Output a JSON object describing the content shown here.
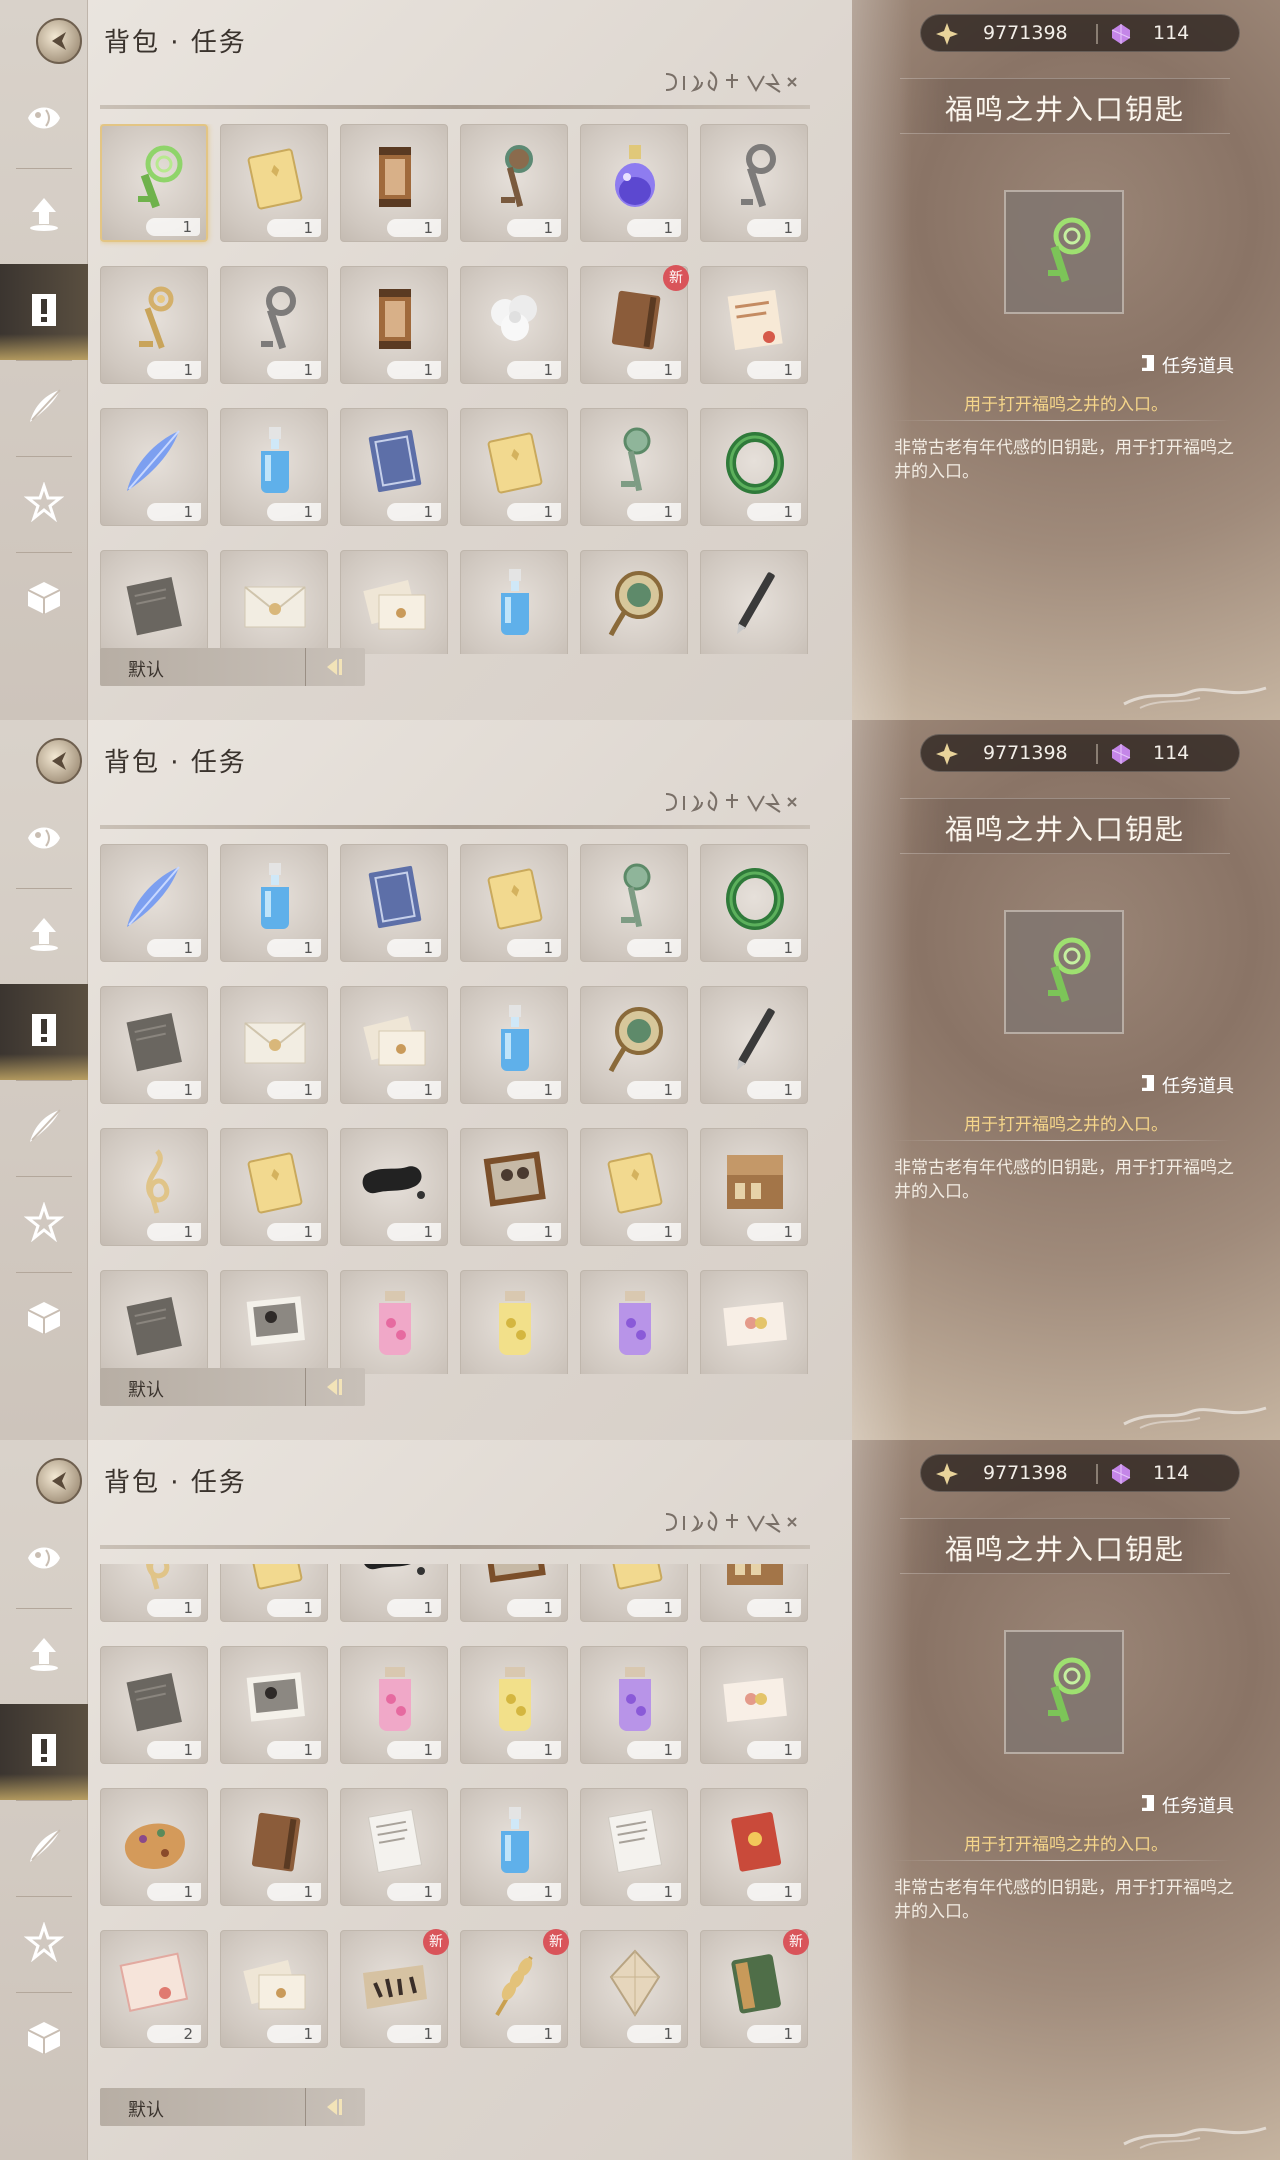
{
  "title": "背包 · 任务",
  "currency": {
    "gold": "9771398",
    "gem": "114"
  },
  "detail": {
    "name": "福鸣之井入口钥匙",
    "category": "任务道具",
    "usage": "用于打开福鸣之井的入口。",
    "description": "非常古老有年代感的旧钥匙，用于打开福鸣之井的入口。"
  },
  "sort_label": "默认",
  "sidebar_icons": [
    "fish-icon",
    "upload-icon",
    "quest-icon",
    "quill-icon",
    "star-icon",
    "cube-icon"
  ],
  "colors": {
    "selected_border": "#e3c584",
    "badge": "#d9545a",
    "usage_text": "#f5d58a"
  },
  "panels": [
    {
      "items": [
        {
          "icon": "green-key",
          "count": "1",
          "selected": true
        },
        {
          "icon": "yellow-book",
          "count": "1"
        },
        {
          "icon": "scroll-case",
          "count": "1"
        },
        {
          "icon": "ornate-key",
          "count": "1"
        },
        {
          "icon": "purple-bottle",
          "count": "1"
        },
        {
          "icon": "silver-key",
          "count": "1"
        },
        {
          "icon": "gold-key",
          "count": "1"
        },
        {
          "icon": "silver-key",
          "count": "1"
        },
        {
          "icon": "scroll-case",
          "count": "1"
        },
        {
          "icon": "white-flower",
          "count": "1"
        },
        {
          "icon": "brown-notebook",
          "count": "1",
          "badge": "新"
        },
        {
          "icon": "letter",
          "count": "1"
        },
        {
          "icon": "blue-feather",
          "count": "1"
        },
        {
          "icon": "blue-bottle",
          "count": "1"
        },
        {
          "icon": "blue-book",
          "count": "1"
        },
        {
          "icon": "yellow-book",
          "count": "1"
        },
        {
          "icon": "green-ornate-key",
          "count": "1"
        },
        {
          "icon": "green-ring",
          "count": "1"
        },
        {
          "icon": "grey-paper"
        },
        {
          "icon": "envelope"
        },
        {
          "icon": "envelopes"
        },
        {
          "icon": "blue-bottle"
        },
        {
          "icon": "tambourine"
        },
        {
          "icon": "pen"
        }
      ]
    },
    {
      "items": [
        {
          "icon": "blue-feather",
          "count": "1"
        },
        {
          "icon": "blue-bottle",
          "count": "1"
        },
        {
          "icon": "blue-book",
          "count": "1"
        },
        {
          "icon": "yellow-book",
          "count": "1"
        },
        {
          "icon": "green-ornate-key",
          "count": "1"
        },
        {
          "icon": "green-ring",
          "count": "1"
        },
        {
          "icon": "grey-paper",
          "count": "1"
        },
        {
          "icon": "envelope",
          "count": "1"
        },
        {
          "icon": "envelopes",
          "count": "1"
        },
        {
          "icon": "blue-bottle",
          "count": "1"
        },
        {
          "icon": "tambourine",
          "count": "1"
        },
        {
          "icon": "pen",
          "count": "1"
        },
        {
          "icon": "treble-clef",
          "count": "1"
        },
        {
          "icon": "yellow-book",
          "count": "1"
        },
        {
          "icon": "black-ink",
          "count": "1"
        },
        {
          "icon": "photo-frame",
          "count": "1"
        },
        {
          "icon": "yellow-book",
          "count": "1"
        },
        {
          "icon": "wooden-box",
          "count": "1"
        },
        {
          "icon": "grey-paper"
        },
        {
          "icon": "photo"
        },
        {
          "icon": "pink-jar"
        },
        {
          "icon": "yellow-jar"
        },
        {
          "icon": "purple-jar"
        },
        {
          "icon": "card"
        }
      ]
    },
    {
      "items": [
        {
          "icon": "treble-clef",
          "count": "1"
        },
        {
          "icon": "yellow-book",
          "count": "1"
        },
        {
          "icon": "black-ink",
          "count": "1"
        },
        {
          "icon": "photo-frame",
          "count": "1"
        },
        {
          "icon": "yellow-book",
          "count": "1"
        },
        {
          "icon": "wooden-box",
          "count": "1"
        },
        {
          "icon": "grey-paper",
          "count": "1"
        },
        {
          "icon": "photo",
          "count": "1"
        },
        {
          "icon": "pink-jar",
          "count": "1"
        },
        {
          "icon": "yellow-jar",
          "count": "1"
        },
        {
          "icon": "purple-jar",
          "count": "1"
        },
        {
          "icon": "card",
          "count": "1"
        },
        {
          "icon": "cookie",
          "count": "1"
        },
        {
          "icon": "brown-notebook",
          "count": "1"
        },
        {
          "icon": "document",
          "count": "1"
        },
        {
          "icon": "blue-bottle",
          "count": "1"
        },
        {
          "icon": "document",
          "count": "1"
        },
        {
          "icon": "red-book",
          "count": "1"
        },
        {
          "icon": "certificate",
          "count": "2"
        },
        {
          "icon": "envelopes",
          "count": "1"
        },
        {
          "icon": "map-paper",
          "count": "1",
          "badge": "新"
        },
        {
          "icon": "wheat",
          "count": "1",
          "badge": "新"
        },
        {
          "icon": "crystal",
          "count": "1"
        },
        {
          "icon": "green-book",
          "count": "1",
          "badge": "新"
        }
      ]
    }
  ]
}
